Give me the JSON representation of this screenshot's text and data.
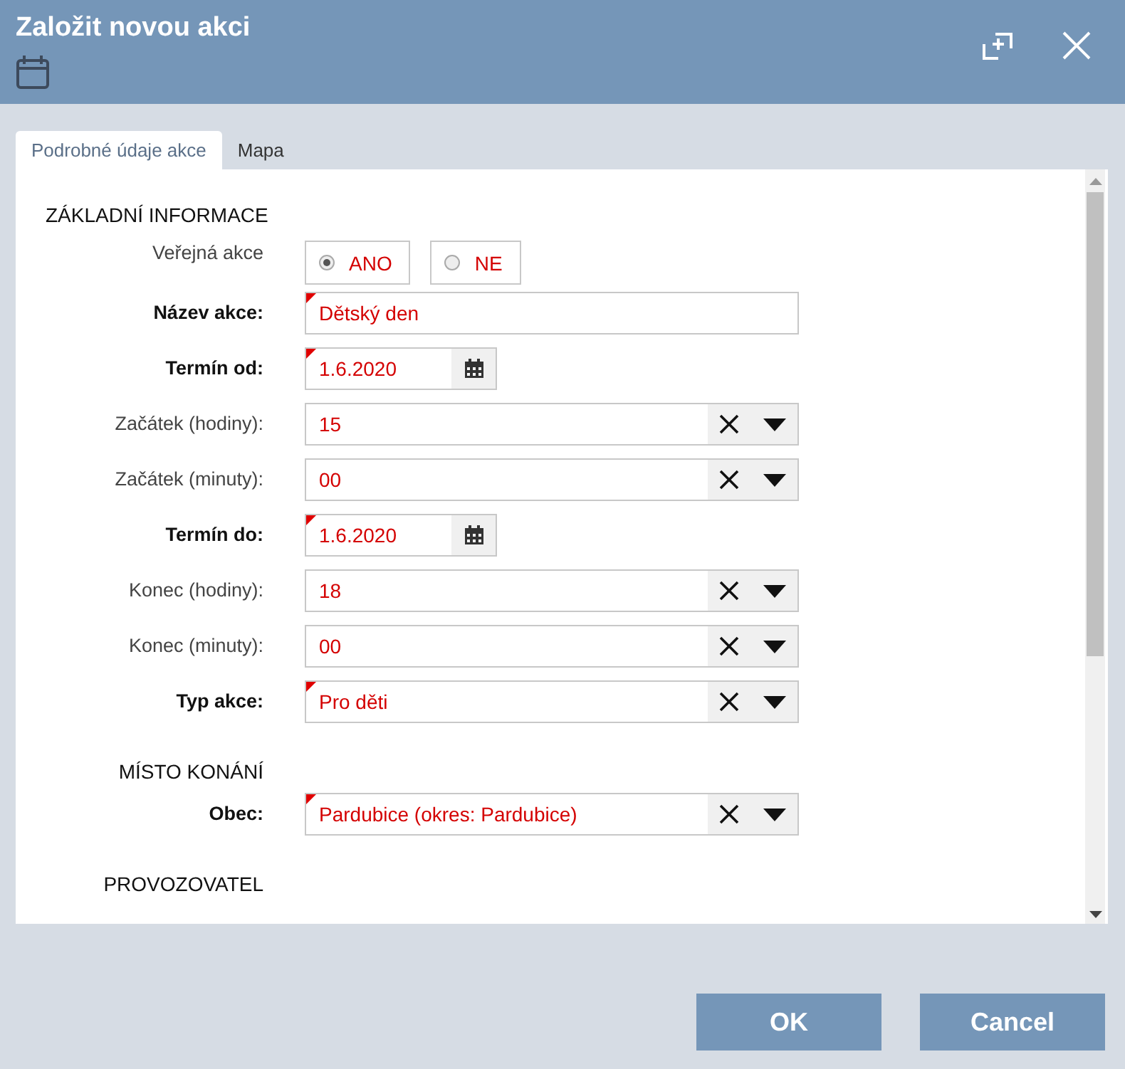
{
  "window": {
    "title": "Založit novou akci"
  },
  "tabs": [
    {
      "label": "Podrobné údaje akce",
      "selected": true
    },
    {
      "label": "Mapa",
      "selected": false
    }
  ],
  "sections": [
    {
      "heading": "ZÁKLADNÍ INFORMACE",
      "kind": "main",
      "fields": [
        {
          "kind": "radio",
          "label": "Veřejná akce",
          "required": false,
          "options": [
            {
              "label": "ANO",
              "selected": true
            },
            {
              "label": "NE",
              "selected": false
            }
          ]
        },
        {
          "kind": "text",
          "label": "Název akce:",
          "required": true,
          "value": "Dětský den"
        },
        {
          "kind": "date",
          "label": "Termín od:",
          "required": true,
          "value": "1.6.2020"
        },
        {
          "kind": "select",
          "label": "Začátek (hodiny):",
          "required": false,
          "value": "15"
        },
        {
          "kind": "select",
          "label": "Začátek (minuty):",
          "required": false,
          "value": "00"
        },
        {
          "kind": "date",
          "label": "Termín do:",
          "required": true,
          "value": "1.6.2020"
        },
        {
          "kind": "select",
          "label": "Konec (hodiny):",
          "required": false,
          "value": "18"
        },
        {
          "kind": "select",
          "label": "Konec (minuty):",
          "required": false,
          "value": "00"
        },
        {
          "kind": "select",
          "label": "Typ akce:",
          "required": true,
          "value": "Pro děti"
        }
      ]
    },
    {
      "heading": "MÍSTO KONÁNÍ",
      "kind": "sub",
      "fields": [
        {
          "kind": "select",
          "label": "Obec:",
          "required": true,
          "value": "Pardubice (okres: Pardubice)"
        }
      ]
    },
    {
      "heading": "PROVOZOVATEL",
      "kind": "sub"
    }
  ],
  "buttons": [
    "OK",
    "Cancel"
  ]
}
